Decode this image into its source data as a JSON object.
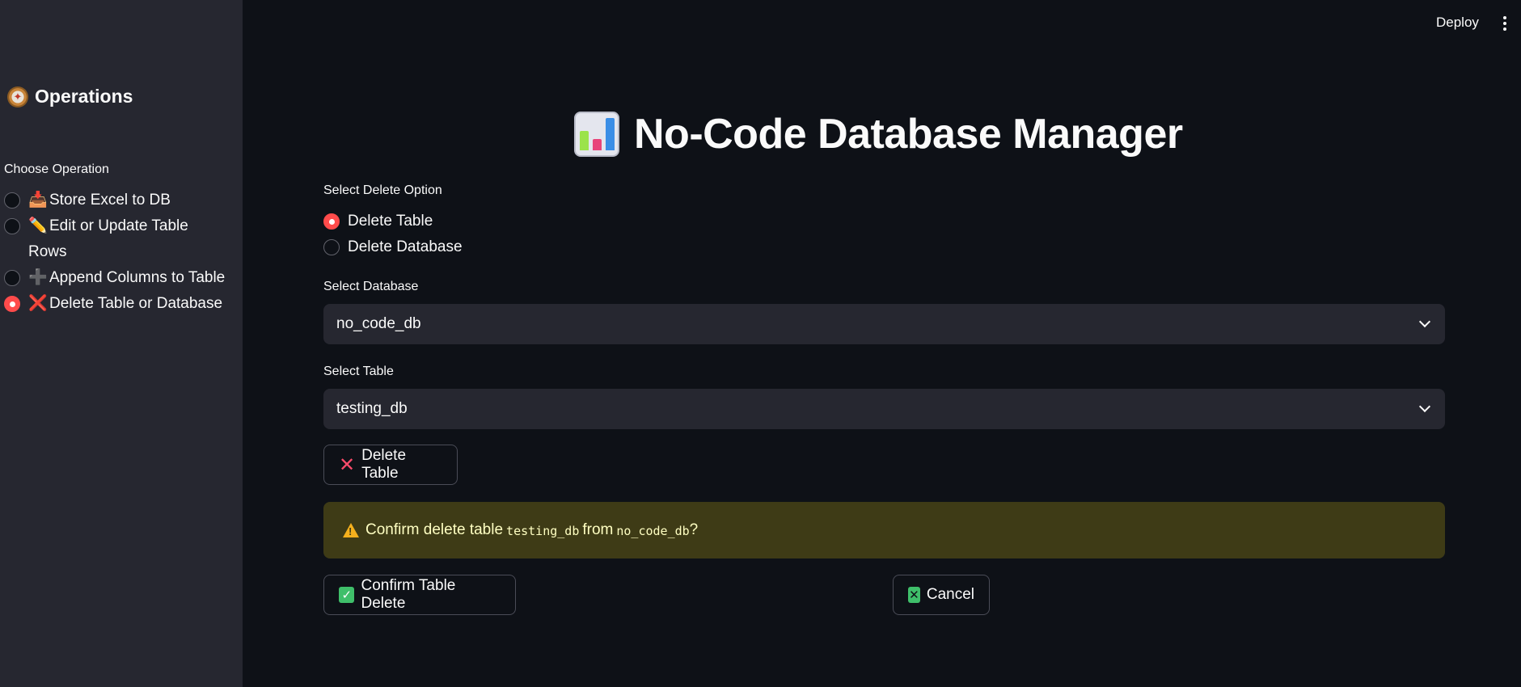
{
  "sidebar": {
    "header": {
      "icon": "compass-icon",
      "title": "Operations"
    },
    "group_label": "Choose Operation",
    "options": [
      {
        "emoji": "📥",
        "label": "Store Excel to DB",
        "selected": false
      },
      {
        "emoji": "✏️",
        "label": "Edit or Update Table Rows",
        "selected": false
      },
      {
        "emoji": "➕",
        "label": "Append Columns to Table",
        "selected": false
      },
      {
        "emoji": "❌",
        "label": "Delete Table or Database",
        "selected": true
      }
    ]
  },
  "topbar": {
    "deploy_label": "Deploy",
    "menu_icon": "kebab-menu-icon"
  },
  "main": {
    "title_icon": "bar-chart-icon",
    "title": "No-Code Database Manager",
    "delete_option": {
      "label": "Select Delete Option",
      "options": [
        {
          "label": "Delete Table",
          "selected": true
        },
        {
          "label": "Delete Database",
          "selected": false
        }
      ]
    },
    "database_select": {
      "label": "Select Database",
      "value": "no_code_db"
    },
    "table_select": {
      "label": "Select Table",
      "value": "testing_db"
    },
    "delete_button_label": "Delete Table",
    "warning": {
      "prefix": "Confirm delete table",
      "table": "testing_db",
      "middle": "from",
      "database": "no_code_db",
      "suffix": "?"
    },
    "confirm_button_label": "Confirm Table Delete",
    "cancel_button_label": "Cancel"
  },
  "colors": {
    "background": "#0e1117",
    "sidebar": "#262730",
    "accent": "#ff4b4b",
    "warning_bg": "#3e3b16",
    "warning_text": "#ffffc2"
  }
}
